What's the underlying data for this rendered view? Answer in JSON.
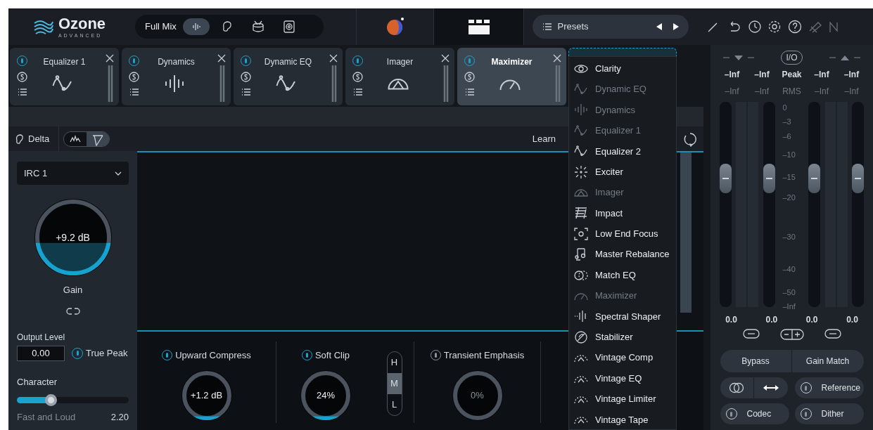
{
  "logo": {
    "name": "Ozone",
    "edition": "ADVANCED"
  },
  "mix": {
    "label": "Full Mix",
    "views": [
      {
        "kind": "wave",
        "selected": true
      },
      {
        "kind": "ear",
        "selected": false
      },
      {
        "kind": "drum",
        "selected": false
      },
      {
        "kind": "speaker",
        "selected": false
      }
    ]
  },
  "presets": {
    "label": "Presets"
  },
  "modules": [
    {
      "name": "Equalizer 1",
      "kind": "eq",
      "on": true,
      "selected": false
    },
    {
      "name": "Dynamics",
      "kind": "dynamics",
      "on": true,
      "selected": false
    },
    {
      "name": "Dynamic EQ",
      "kind": "dyn_eq",
      "on": true,
      "selected": false
    },
    {
      "name": "Imager",
      "kind": "imager",
      "on": true,
      "selected": false
    },
    {
      "name": "Maximizer",
      "kind": "maximizer",
      "on": true,
      "selected": true
    }
  ],
  "toolbar": {
    "delta": "Delta",
    "views": [
      {
        "kind": "spectrum",
        "selected": false
      },
      {
        "kind": "curve",
        "selected": true
      }
    ],
    "learn": "Learn"
  },
  "maximizer": {
    "mode": "IRC 1",
    "gain": {
      "value": "+9.2 dB",
      "label": "Gain"
    },
    "output_level": {
      "label": "Output Level",
      "value": "0.00"
    },
    "true_peak": {
      "label": "True Peak",
      "on": true
    },
    "character": {
      "label": "Character",
      "level": 0.3,
      "caption": "Fast and Loud",
      "value": "2.20"
    }
  },
  "sections": [
    {
      "kind": "knob",
      "title": "Upward Compress",
      "on": true,
      "value": "+1.2 dB"
    },
    {
      "kind": "knob",
      "title": "Soft Clip",
      "on": true,
      "value": "24%"
    },
    {
      "kind": "selector",
      "options": [
        {
          "label": "H",
          "selected": false
        },
        {
          "label": "M",
          "selected": true
        },
        {
          "label": "L",
          "selected": false
        }
      ]
    },
    {
      "kind": "knob",
      "title": "Transient Emphasis",
      "on": false,
      "value": "0%"
    }
  ],
  "menu": {
    "items": [
      {
        "label": "Clarity",
        "kind": "clarity",
        "disabled": false
      },
      {
        "label": "Dynamic EQ",
        "kind": "dyn_eq",
        "disabled": true
      },
      {
        "label": "Dynamics",
        "kind": "dynamics",
        "disabled": true
      },
      {
        "label": "Equalizer 1",
        "kind": "eq",
        "disabled": true
      },
      {
        "label": "Equalizer 2",
        "kind": "eq",
        "disabled": false
      },
      {
        "label": "Exciter",
        "kind": "exciter",
        "disabled": false
      },
      {
        "label": "Imager",
        "kind": "imager",
        "disabled": true
      },
      {
        "label": "Impact",
        "kind": "impact",
        "disabled": false
      },
      {
        "label": "Low End Focus",
        "kind": "low_end",
        "disabled": false
      },
      {
        "label": "Master Rebalance",
        "kind": "rebalance",
        "disabled": false
      },
      {
        "label": "Match EQ",
        "kind": "match_eq",
        "disabled": false
      },
      {
        "label": "Maximizer",
        "kind": "maximizer",
        "disabled": true
      },
      {
        "label": "Spectral Shaper",
        "kind": "spectral",
        "disabled": false
      },
      {
        "label": "Stabilizer",
        "kind": "stabilizer",
        "disabled": false
      },
      {
        "label": "Vintage Comp",
        "kind": "vintage",
        "disabled": false
      },
      {
        "label": "Vintage EQ",
        "kind": "vintage",
        "disabled": false
      },
      {
        "label": "Vintage Limiter",
        "kind": "vintage",
        "disabled": false
      },
      {
        "label": "Vintage Tape",
        "kind": "vintage",
        "disabled": false
      }
    ]
  },
  "meters": {
    "io": "I/O",
    "peak_row": [
      "–Inf",
      "–Inf",
      "Peak",
      "–Inf",
      "–Inf"
    ],
    "rms_row": [
      "–Inf",
      "–Inf",
      "RMS",
      "–Inf",
      "–Inf"
    ],
    "scale": [
      "0",
      "–3",
      "–6",
      "–10",
      "–15",
      "–20",
      "–30",
      "–40",
      "–50",
      "–Inf"
    ],
    "faders": [
      {
        "level": 0.65,
        "reading": "0.0"
      },
      {
        "level": 0.65,
        "reading": "0.0"
      },
      {
        "level": 0.65,
        "reading": "0.0"
      },
      {
        "level": 0.65,
        "reading": "0.0"
      }
    ],
    "buttons": {
      "bypass": "Bypass",
      "gain_match": "Gain Match",
      "reference": "Reference",
      "codec": "Codec",
      "dither": "Dither"
    }
  }
}
